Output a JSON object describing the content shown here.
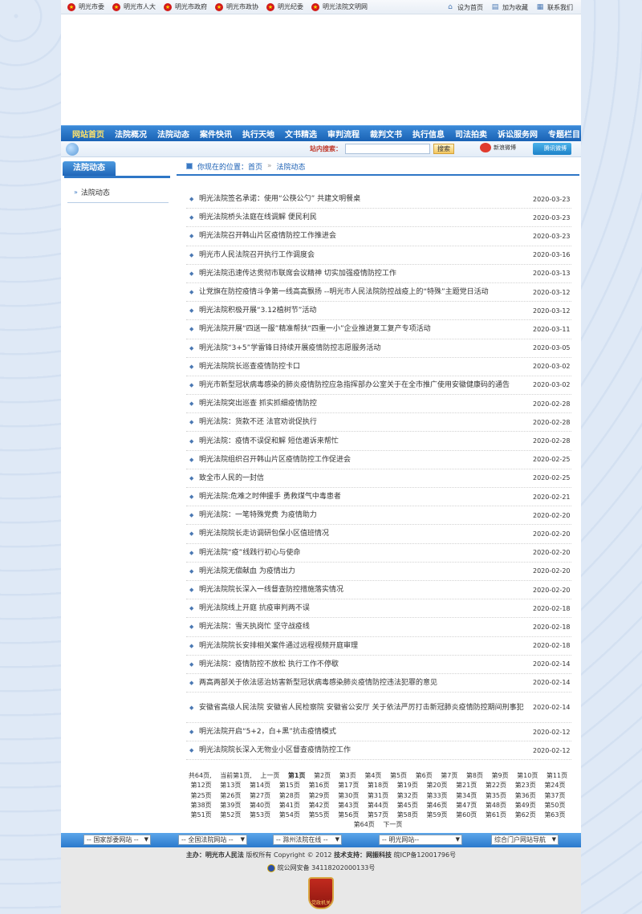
{
  "top_links": [
    "明光市委",
    "明光市人大",
    "明光市政府",
    "明光市政协",
    "明光纪委",
    "明光法院文明网"
  ],
  "toolbar": {
    "home": "设为首页",
    "favorite": "加为收藏",
    "contact": "联系我们"
  },
  "nav": [
    "网站首页",
    "法院概况",
    "法院动态",
    "案件快讯",
    "执行天地",
    "文书精选",
    "审判流程",
    "裁判文书",
    "执行信息",
    "司法拍卖",
    "诉讼服务网",
    "专题栏目"
  ],
  "search": {
    "label": "站内搜索：",
    "button": "搜索",
    "value": ""
  },
  "weibo": {
    "sina": "新浪微博",
    "tencent": "腾讯微博"
  },
  "sidebar": {
    "title": "法院动态",
    "items": [
      "法院动态"
    ]
  },
  "breadcrumb": {
    "prefix": "你现在的位置：",
    "home": "首页",
    "sep": "»",
    "current": "法院动态"
  },
  "news": [
    {
      "title": "明光法院签名承诺：使用“公筷公勺” 共建文明餐桌",
      "date": "2020-03-23"
    },
    {
      "title": "明光法院桥头法庭在线调解 便民利民",
      "date": "2020-03-23"
    },
    {
      "title": "明光法院召开韩山片区疫情防控工作推进会",
      "date": "2020-03-23"
    },
    {
      "title": "明光市人民法院召开执行工作调度会",
      "date": "2020-03-16"
    },
    {
      "title": "明光法院迅速传达贯彻市联席会议精神 切实加强疫情防控工作",
      "date": "2020-03-13"
    },
    {
      "title": "让党旗在防控疫情斗争第一线高高飘扬 --明光市人民法院防控战疫上的“特殊”主题党日活动",
      "date": "2020-03-12"
    },
    {
      "title": "明光法院积极开展“3.12植树节”活动",
      "date": "2020-03-12"
    },
    {
      "title": "明光法院开展“四送一服”精准帮扶“四重一小”企业推进复工复产专项活动",
      "date": "2020-03-11"
    },
    {
      "title": "明光法院“3+5”学雷锋日持续开展疫情防控志愿服务活动",
      "date": "2020-03-05"
    },
    {
      "title": "明光法院院长巡查疫情防控卡口",
      "date": "2020-03-02"
    },
    {
      "title": "明光市新型冠状病毒感染的肺炎疫情防控应急指挥部办公室关于在全市推广使用安徽健康码的通告",
      "date": "2020-03-02"
    },
    {
      "title": "明光法院突出巡查 抓实抓细疫情防控",
      "date": "2020-02-28"
    },
    {
      "title": "明光法院：货款不还 法官劝说促执行",
      "date": "2020-02-28"
    },
    {
      "title": "明光法院：疫情不误促和解 短信邀诉来帮忙",
      "date": "2020-02-28"
    },
    {
      "title": "明光法院组织召开韩山片区疫情防控工作促进会",
      "date": "2020-02-25"
    },
    {
      "title": "致全市人民的一封信",
      "date": "2020-02-25"
    },
    {
      "title": "明光法院:危难之时伸援手 勇救煤气中毒患者",
      "date": "2020-02-21"
    },
    {
      "title": "明光法院：一笔特殊党费 为疫情助力",
      "date": "2020-02-20"
    },
    {
      "title": "明光法院院长走访调研包保小区值班情况",
      "date": "2020-02-20"
    },
    {
      "title": "明光法院“疫”线践行初心与使命",
      "date": "2020-02-20"
    },
    {
      "title": "明光法院无偿献血 为疫情出力",
      "date": "2020-02-20"
    },
    {
      "title": "明光法院院长深入一线督查防控措施落实情况",
      "date": "2020-02-20"
    },
    {
      "title": "明光法院线上开庭 抗疫审判两不误",
      "date": "2020-02-18"
    },
    {
      "title": "明光法院：雪天执岗忙 坚守战疫线",
      "date": "2020-02-18"
    },
    {
      "title": "明光法院院长安排相关案件通过远程视频开庭审理",
      "date": "2020-02-18"
    },
    {
      "title": "明光法院：疫情防控不放松 执行工作不停歇",
      "date": "2020-02-14"
    },
    {
      "title": "两高两部关于依法惩治妨害新型冠状病毒感染肺炎疫情防控违法犯罪的意见",
      "date": "2020-02-14"
    },
    {
      "title": "安徽省高级人民法院 安徽省人民检察院 安徽省公安厅 关于依法严厉打击新冠肺炎疫情防控期间刑事犯",
      "date": "2020-02-14"
    },
    {
      "title": "明光法院开启“5+2，白+黑”抗击疫情模式",
      "date": "2020-02-12"
    },
    {
      "title": "明光法院院长深入无物业小区督查疫情防控工作",
      "date": "2020-02-12"
    }
  ],
  "pager": {
    "total": "共64页,",
    "current_info": "当前第1页,",
    "prev": "上一页",
    "next": "下一页",
    "current_page": "第1页",
    "pages": [
      "第2页",
      "第3页",
      "第4页",
      "第5页",
      "第6页",
      "第7页",
      "第8页",
      "第9页",
      "第10页",
      "第11页",
      "第12页",
      "第13页",
      "第14页",
      "第15页",
      "第16页",
      "第17页",
      "第18页",
      "第19页",
      "第20页",
      "第21页",
      "第22页",
      "第23页",
      "第24页",
      "第25页",
      "第26页",
      "第27页",
      "第28页",
      "第29页",
      "第30页",
      "第31页",
      "第32页",
      "第33页",
      "第34页",
      "第35页",
      "第36页",
      "第37页",
      "第38页",
      "第39页",
      "第40页",
      "第41页",
      "第42页",
      "第43页",
      "第44页",
      "第45页",
      "第46页",
      "第47页",
      "第48页",
      "第49页",
      "第50页",
      "第51页",
      "第52页",
      "第53页",
      "第54页",
      "第55页",
      "第56页",
      "第57页",
      "第58页",
      "第59页",
      "第60页",
      "第61页",
      "第62页",
      "第63页",
      "第64页"
    ]
  },
  "footer_selects": [
    "-- 国家部委网站 --",
    "-- 全国法院网站 --",
    "-- 滁州法院在线 --",
    "-- 明光网站--",
    "综合门户网站导航"
  ],
  "footer": {
    "host_label": "主办：",
    "host": "明光市人民法",
    "rights": "版权所有 Copyright © 2012",
    "tech_label": "技术支持：",
    "tech": "网振科技",
    "icp": "皖ICP备12001796号",
    "police": "皖公网安备 34118202000133号",
    "badge": "党政机关"
  },
  "colors": {
    "nav": "#1a62b5",
    "accent": "#2e76c6",
    "link": "#1a5fb4"
  }
}
